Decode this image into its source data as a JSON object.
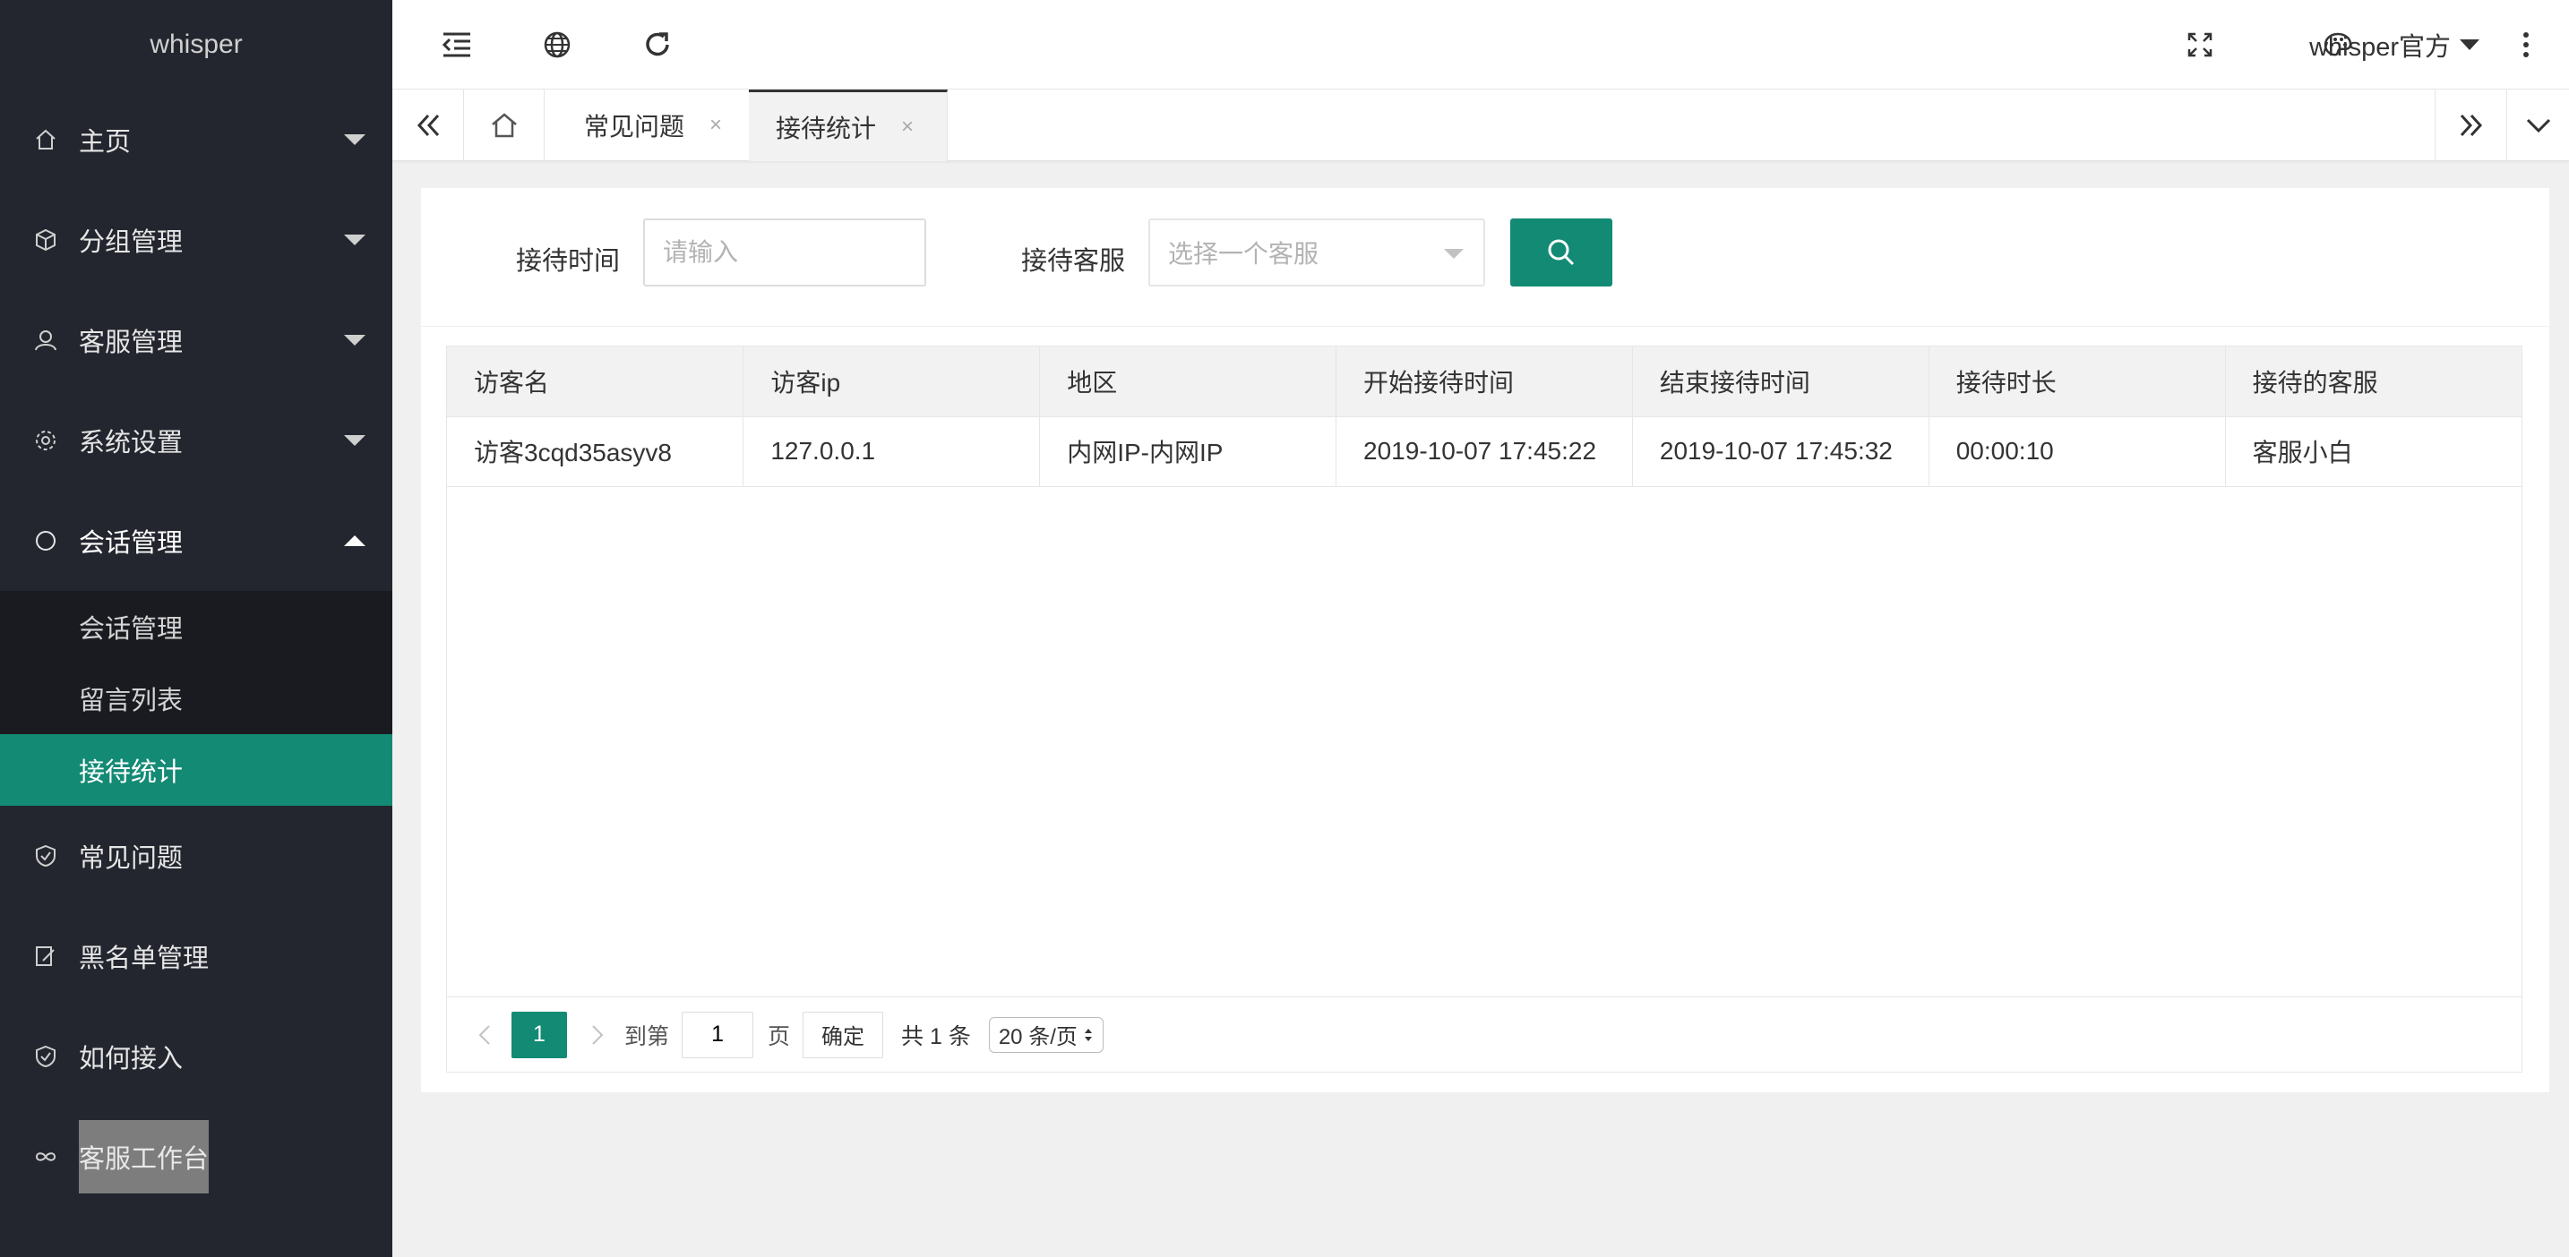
{
  "app": {
    "logo": "whisper"
  },
  "sidebar": {
    "items": [
      {
        "label": "主页",
        "icon": "home-icon"
      },
      {
        "label": "分组管理",
        "icon": "cube-icon"
      },
      {
        "label": "客服管理",
        "icon": "user-icon"
      },
      {
        "label": "系统设置",
        "icon": "gear-icon"
      },
      {
        "label": "会话管理",
        "icon": "chat-icon"
      },
      {
        "label": "常见问题",
        "icon": "shield-icon"
      },
      {
        "label": "黑名单管理",
        "icon": "edit-icon"
      },
      {
        "label": "如何接入",
        "icon": "shield-icon"
      },
      {
        "label": "客服工作台",
        "icon": "link-icon"
      }
    ],
    "sub_items": [
      {
        "label": "会话管理"
      },
      {
        "label": "留言列表"
      },
      {
        "label": "接待统计"
      }
    ]
  },
  "header": {
    "user": "whisper官方"
  },
  "tabs": [
    {
      "label": "常见问题",
      "close": "×"
    },
    {
      "label": "接待统计",
      "close": "×"
    }
  ],
  "filter": {
    "time_label": "接待时间",
    "time_placeholder": "请输入",
    "service_label": "接待客服",
    "service_placeholder": "选择一个客服"
  },
  "table": {
    "columns": [
      "访客名",
      "访客ip",
      "地区",
      "开始接待时间",
      "结束接待时间",
      "接待时长",
      "接待的客服"
    ],
    "rows": [
      [
        "访客3cqd35asyv8",
        "127.0.0.1",
        "内网IP-内网IP",
        "2019-10-07 17:45:22",
        "2019-10-07 17:45:32",
        "00:00:10",
        "客服小白"
      ]
    ]
  },
  "pager": {
    "current": "1",
    "goto_label": "到第",
    "goto_value": "1",
    "page_label": "页",
    "confirm": "确定",
    "total": "共 1 条",
    "page_size": "20 条/页"
  },
  "colors": {
    "accent": "#138a74",
    "sidebar": "#23262e"
  }
}
